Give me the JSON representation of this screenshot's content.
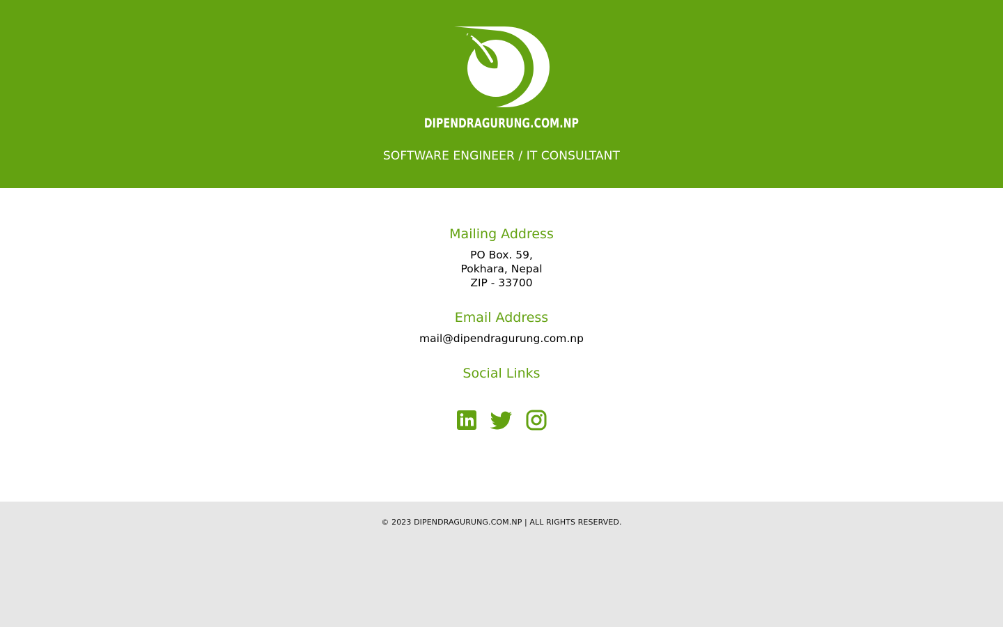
{
  "header": {
    "logo_icon": "dg-leaf-logo-icon",
    "brand": "DIPENDRAGURUNG.COM.NP",
    "tagline": "SOFTWARE ENGINEER / IT CONSULTANT"
  },
  "mailing": {
    "heading": "Mailing Address",
    "lines": [
      "PO Box. 59,",
      "Pokhara, Nepal",
      "ZIP - 33700"
    ]
  },
  "email": {
    "heading": "Email Address",
    "address": "mail@dipendragurung.com.np"
  },
  "social": {
    "heading": "Social Links",
    "icons": [
      "linkedin-icon",
      "twitter-icon",
      "instagram-icon"
    ]
  },
  "footer": {
    "copyright": "© 2023 DIPENDRAGURUNG.COM.NP | ALL RIGHTS RESERVED."
  },
  "colors": {
    "brand_green": "#63a211",
    "footer_bg": "#e6e6e6",
    "white": "#ffffff"
  }
}
